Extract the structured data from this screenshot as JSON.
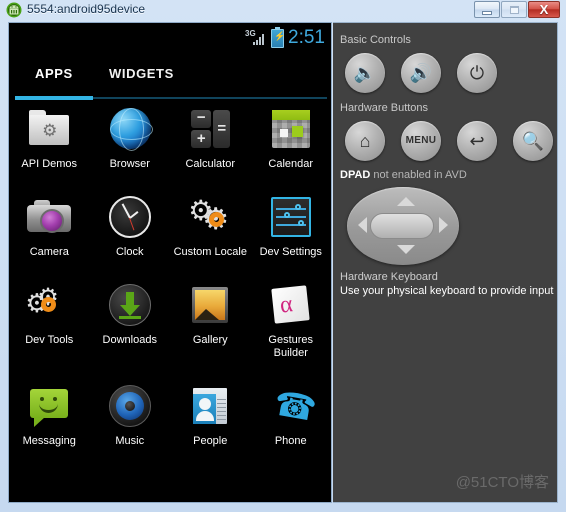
{
  "window": {
    "title": "5554:android95device",
    "icon": "android-robot-icon",
    "buttons": {
      "minimize": "minimize-button",
      "maximize": "maximize-button",
      "close_label": "X"
    }
  },
  "device": {
    "statusbar": {
      "network_type": "3G",
      "signal_icon": "signal-bars-icon",
      "battery_icon": "battery-charging-icon",
      "time": "2:51"
    },
    "tabs": [
      {
        "label": "APPS",
        "active": true
      },
      {
        "label": "WIDGETS",
        "active": false
      }
    ],
    "apps": [
      {
        "label": "API Demos",
        "icon": "api-demos-icon"
      },
      {
        "label": "Browser",
        "icon": "browser-icon"
      },
      {
        "label": "Calculator",
        "icon": "calculator-icon"
      },
      {
        "label": "Calendar",
        "icon": "calendar-icon"
      },
      {
        "label": "Camera",
        "icon": "camera-icon"
      },
      {
        "label": "Clock",
        "icon": "clock-icon"
      },
      {
        "label": "Custom Locale",
        "icon": "custom-locale-icon"
      },
      {
        "label": "Dev Settings",
        "icon": "dev-settings-icon"
      },
      {
        "label": "Dev Tools",
        "icon": "dev-tools-icon"
      },
      {
        "label": "Downloads",
        "icon": "downloads-icon"
      },
      {
        "label": "Gallery",
        "icon": "gallery-icon"
      },
      {
        "label": "Gestures Builder",
        "icon": "gestures-builder-icon"
      },
      {
        "label": "Messaging",
        "icon": "messaging-icon"
      },
      {
        "label": "Music",
        "icon": "music-icon"
      },
      {
        "label": "People",
        "icon": "people-icon"
      },
      {
        "label": "Phone",
        "icon": "phone-icon"
      }
    ]
  },
  "panel": {
    "basic_controls_title": "Basic Controls",
    "basic_controls": [
      {
        "name": "volume-down-button",
        "glyph": "🔈"
      },
      {
        "name": "volume-up-button",
        "glyph": "🔊"
      },
      {
        "name": "power-button",
        "glyph": "⏻"
      }
    ],
    "hardware_buttons_title": "Hardware Buttons",
    "hardware_buttons": [
      {
        "name": "home-button",
        "glyph": "⌂"
      },
      {
        "name": "menu-button",
        "glyph": "MENU"
      },
      {
        "name": "back-button",
        "glyph": "↩"
      },
      {
        "name": "search-button",
        "glyph": "🔍"
      }
    ],
    "dpad_label": "DPAD",
    "dpad_note": " not enabled in AVD",
    "keyboard_title": "Hardware Keyboard",
    "keyboard_desc": "Use your physical keyboard to provide input"
  },
  "watermark": "@51CTO博客",
  "colors": {
    "accent_blue": "#33b5e5",
    "panel_bg": "#414141",
    "screen_bg": "#000000",
    "window_chrome": "#c6d9f0"
  }
}
